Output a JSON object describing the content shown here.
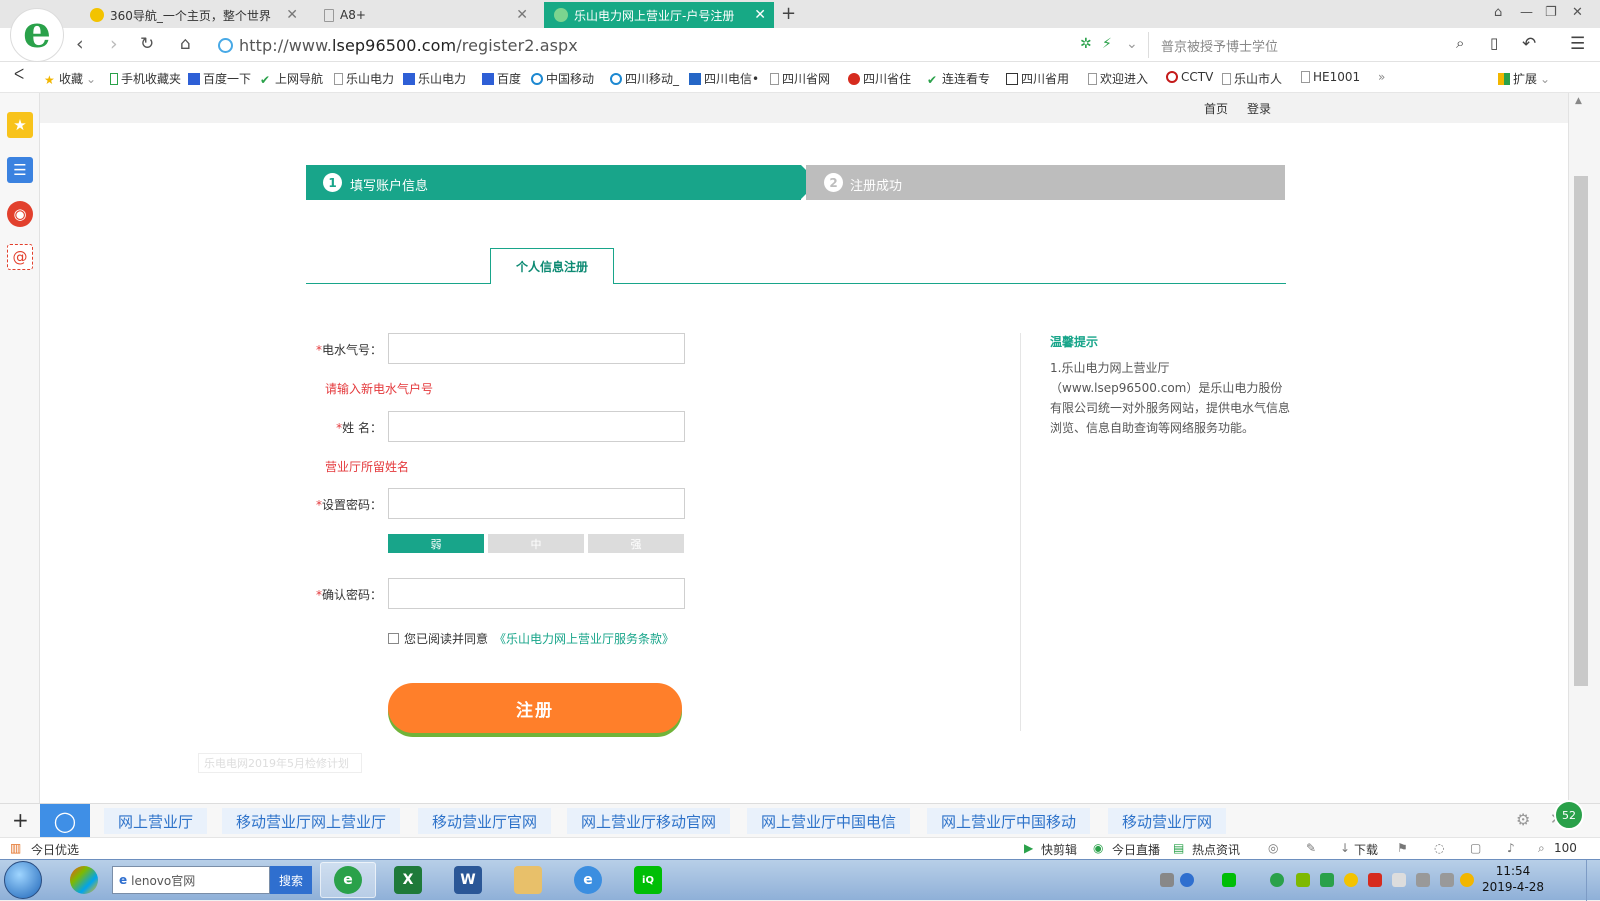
{
  "browser": {
    "tabs": [
      {
        "label": "360导航_一个主页，整个世界",
        "active": false
      },
      {
        "label": "A8+",
        "active": false
      },
      {
        "label": "乐山电力网上营业厅-户号注册",
        "active": true
      }
    ],
    "url_prefix": "http://www.",
    "url_domain": "lsep96500.com",
    "url_path": "/register2.aspx",
    "search_text": "普京被授予博士学位",
    "bookmarks": [
      "收藏",
      "手机收藏夹",
      "百度一下",
      "上网导航",
      "乐山电力",
      "乐山电力",
      "百度",
      "中国移动",
      "四川移动_",
      "四川电信•",
      "四川省网",
      "四川省住",
      "连连看专",
      "四川省用",
      "欢迎进入",
      "CCTV",
      "乐山市人",
      "HE1001"
    ],
    "extend_label": "扩展",
    "more_symbol": "»"
  },
  "page": {
    "top_links": {
      "home": "首页",
      "login": "登录"
    },
    "steps": [
      {
        "num": "1",
        "label": "填写账户信息"
      },
      {
        "num": "2",
        "label": "注册成功"
      }
    ],
    "reg_tab": "个人信息注册",
    "form": {
      "account_label": "电水气号：",
      "account_hint": "请输入新电水气户号",
      "name_label": "姓 名：",
      "name_hint": "营业厅所留姓名",
      "password_label": "设置密码：",
      "strength": [
        "弱",
        "中",
        "强"
      ],
      "confirm_label": "确认密码：",
      "agree_text": "您已阅读并同意",
      "agree_link": "《乐山电力网上营业厅服务条款》",
      "submit": "注册",
      "required_mark": "*"
    },
    "tips": {
      "title": "温馨提示",
      "body": "1.乐山电力网上营业厅（www.lsep96500.com）是乐山电力股份有限公司统一对外服务网站，提供电水气信息浏览、信息自助查询等网络服务功能。"
    },
    "ghost_text": "乐电电网2019年5月检修计划"
  },
  "suggestions": [
    "网上营业厅",
    "移动营业厅网上营业厅",
    "移动营业厅官网",
    "网上营业厅移动官网",
    "网上营业厅中国电信",
    "网上营业厅中国移动",
    "移动营业厅网"
  ],
  "statusbar": {
    "left": "今日优选",
    "items": [
      "快剪辑",
      "今日直播",
      "热点资讯"
    ],
    "download": "下载",
    "zoom": "100"
  },
  "taskbar": {
    "search_text": "lenovo官网",
    "search_button": "搜索",
    "time": "11:54",
    "date": "2019-4-28",
    "badge": "52"
  },
  "colors": {
    "accent": "#18a58a",
    "register_button": "#ff7f2a",
    "required": "#e4393c"
  }
}
